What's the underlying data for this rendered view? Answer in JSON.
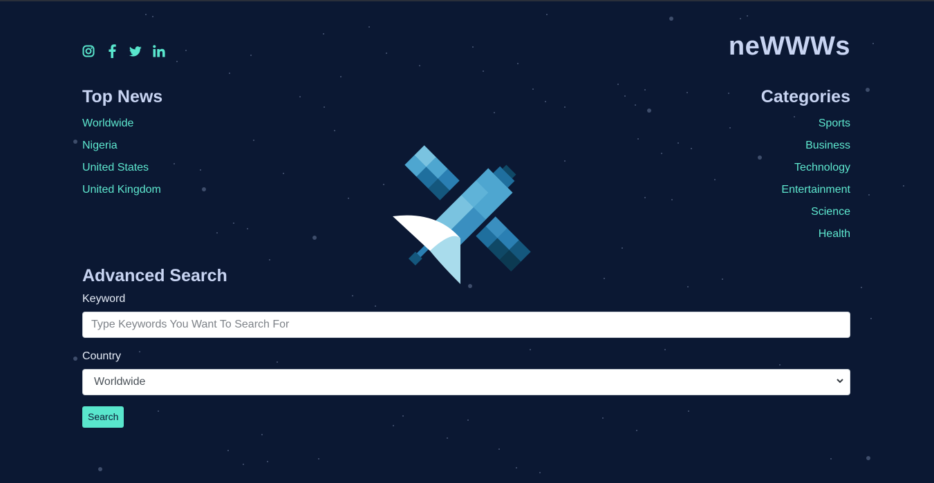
{
  "brand": "neWWWs",
  "social": [
    {
      "icon": "instagram-icon"
    },
    {
      "icon": "facebook-icon"
    },
    {
      "icon": "twitter-icon"
    },
    {
      "icon": "linkedin-icon"
    }
  ],
  "top_news": {
    "title": "Top News",
    "items": [
      "Worldwide",
      "Nigeria",
      "United States",
      "United Kingdom"
    ]
  },
  "categories": {
    "title": "Categories",
    "items": [
      "Sports",
      "Business",
      "Technology",
      "Entertainment",
      "Science",
      "Health"
    ]
  },
  "advanced_search": {
    "title": "Advanced Search",
    "keyword_label": "Keyword",
    "keyword_placeholder": "Type Keywords You Want To Search For",
    "country_label": "Country",
    "country_selected": "Worldwide",
    "search_button": "Search"
  },
  "colors": {
    "background": "#0b1833",
    "accent": "#59e6cd",
    "heading": "#c8d4f2"
  }
}
